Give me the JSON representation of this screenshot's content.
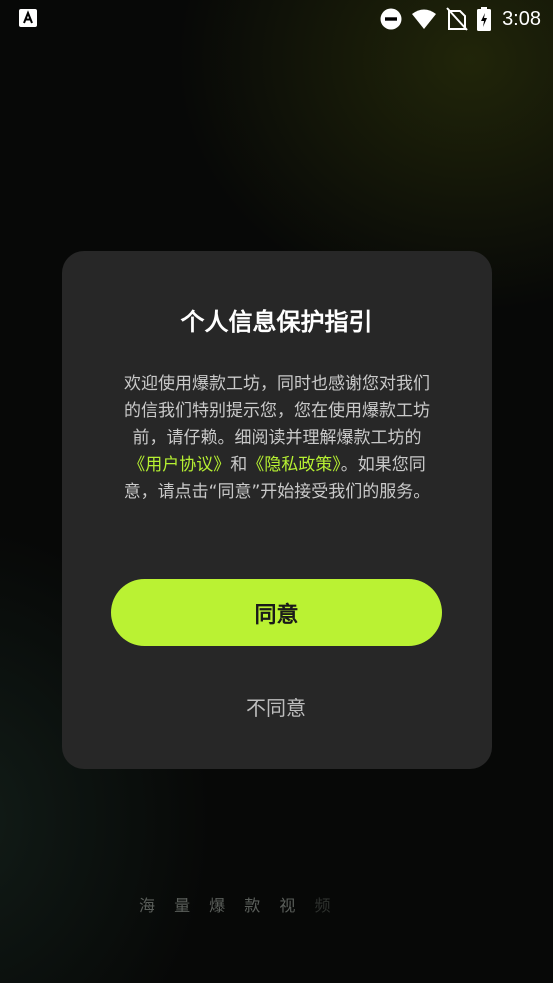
{
  "status_bar": {
    "time": "3:08",
    "icons": [
      "app-notification-icon",
      "do-not-disturb-icon",
      "wifi-icon",
      "no-sim-icon",
      "battery-charging-icon"
    ]
  },
  "background": {
    "slogan_visible": "海 量 爆 款 视",
    "slogan_faded": "频"
  },
  "dialog": {
    "title": "个人信息保护指引",
    "body_part1": "欢迎使用爆款工坊，同时也感谢您对我们的信我们特别提示您，您在使用爆款工坊前，请仔赖。细阅读并理解爆款工坊的",
    "user_agreement_link": "《用户协议》",
    "body_and": "和",
    "privacy_policy_link": "《隐私政策》",
    "body_part2": "。如果您同意，请点击“同意”开始接受我们的服务。",
    "agree_label": "同意",
    "disagree_label": "不同意"
  },
  "colors": {
    "accent": "#baf233",
    "link": "#b6f032",
    "dialog_bg": "#272727",
    "page_bg": "#070807"
  }
}
